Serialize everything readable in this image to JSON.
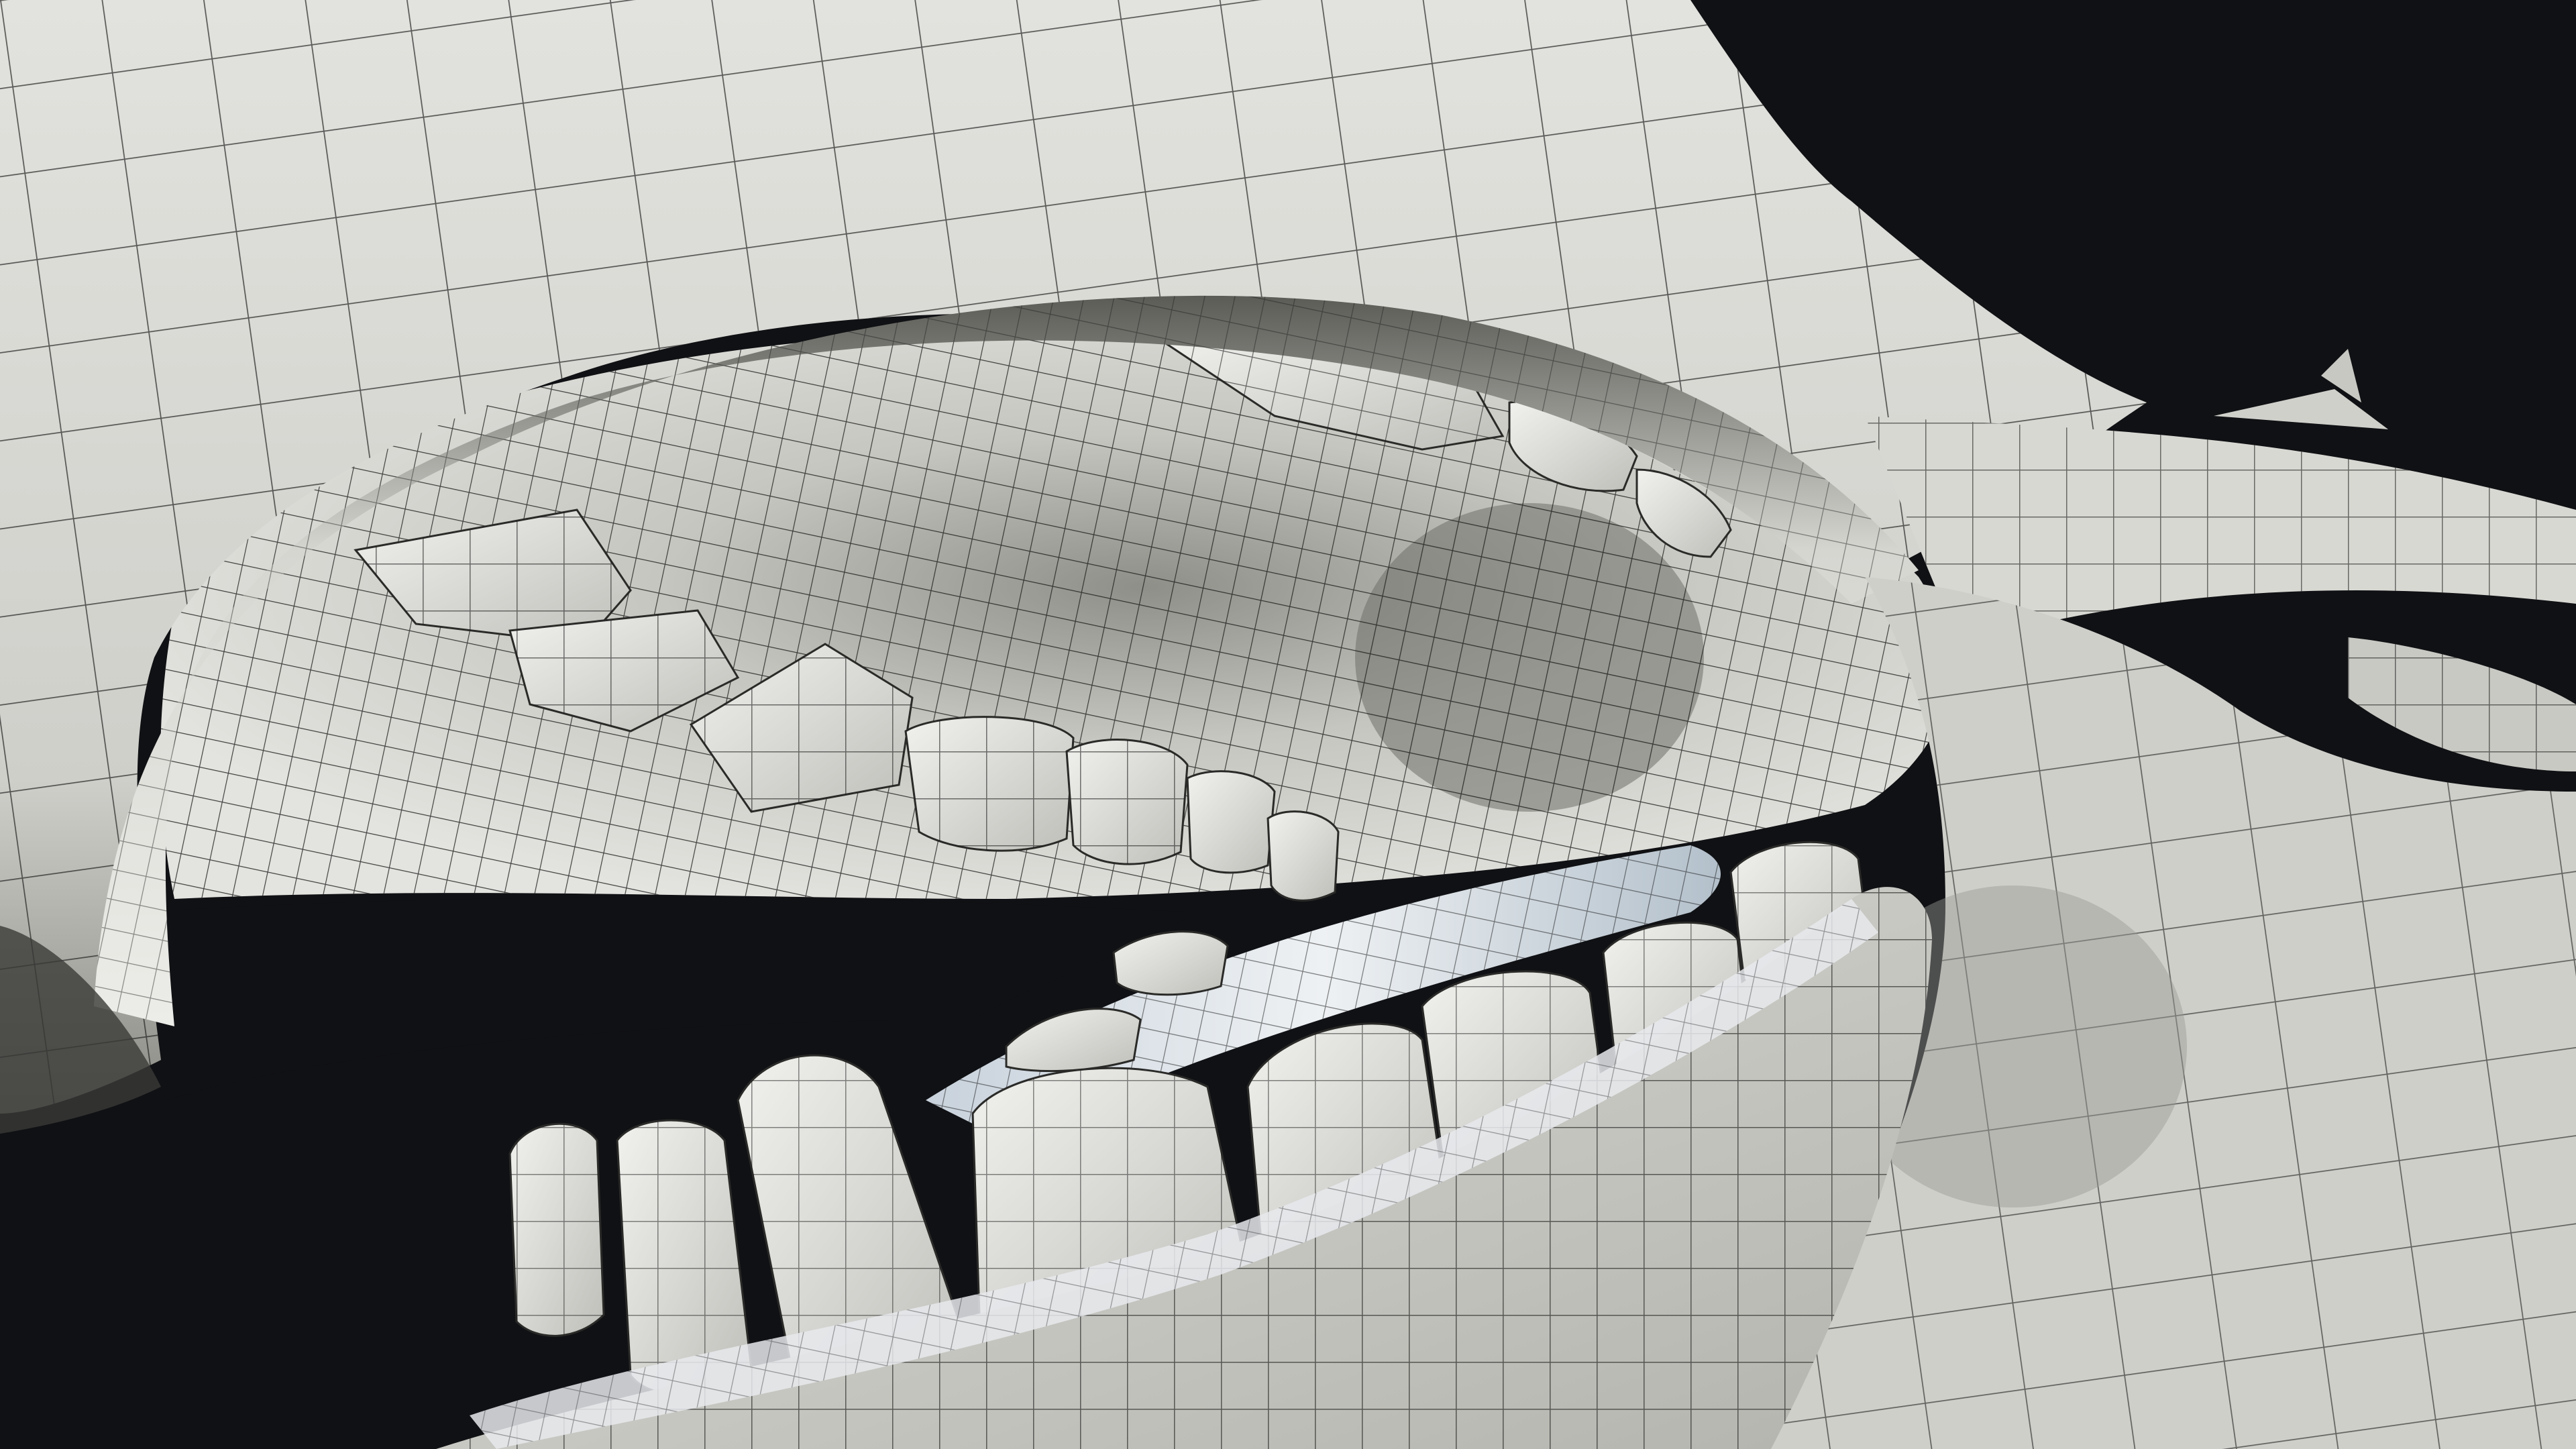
{
  "scene": {
    "subject": "wireframe-render-of-mouth-and-teeth",
    "background_color": "#101114",
    "clay_color": "#cfcfcb",
    "clay_shadow_color": "#8e8e88",
    "interior_color": "#bdbdb7",
    "wire_color": "#1a1a1a",
    "tongue_highlight_color": "#a9b8c6"
  }
}
